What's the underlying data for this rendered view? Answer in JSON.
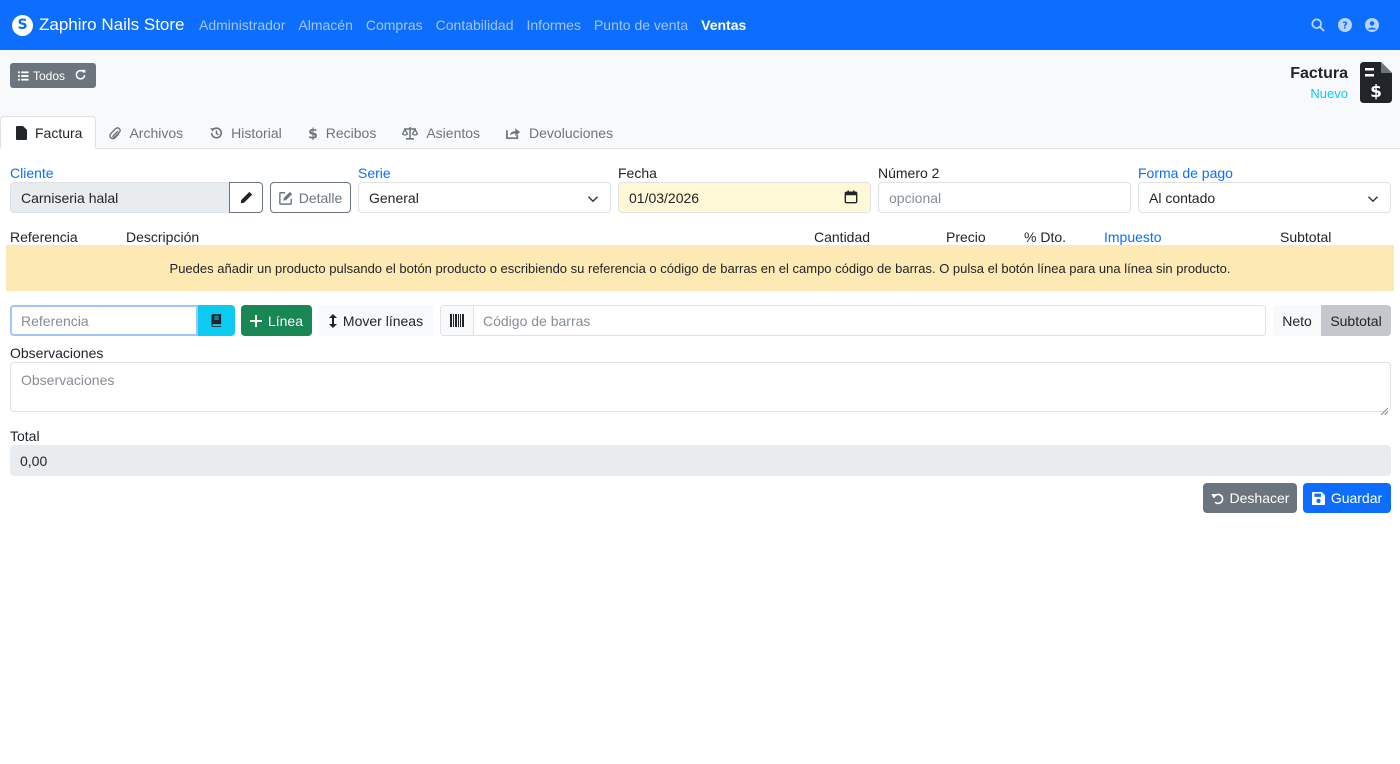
{
  "navbar": {
    "brand": "Zaphiro Nails Store",
    "items": [
      {
        "label": "Administrador",
        "active": false
      },
      {
        "label": "Almacén",
        "active": false
      },
      {
        "label": "Compras",
        "active": false
      },
      {
        "label": "Contabilidad",
        "active": false
      },
      {
        "label": "Informes",
        "active": false
      },
      {
        "label": "Punto de venta",
        "active": false
      },
      {
        "label": "Ventas",
        "active": true
      }
    ],
    "icons": [
      "search-icon",
      "help-icon",
      "user-icon"
    ]
  },
  "toolbar": {
    "todos_label": "Todos"
  },
  "document": {
    "title": "Factura",
    "status": "Nuevo"
  },
  "tabs": [
    {
      "label": "Factura",
      "icon": "file-icon",
      "active": true
    },
    {
      "label": "Archivos",
      "icon": "paperclip-icon",
      "active": false
    },
    {
      "label": "Historial",
      "icon": "history-icon",
      "active": false
    },
    {
      "label": "Recibos",
      "icon": "dollar-icon",
      "active": false
    },
    {
      "label": "Asientos",
      "icon": "balance-scale-icon",
      "active": false
    },
    {
      "label": "Devoluciones",
      "icon": "share-icon",
      "active": false
    }
  ],
  "form": {
    "cliente_label": "Cliente",
    "cliente_value": "Carniseria halal",
    "detalle_label": "Detalle",
    "serie_label": "Serie",
    "serie_value": "General",
    "fecha_label": "Fecha",
    "fecha_value": "01/03/2026",
    "numero2_label": "Número 2",
    "numero2_placeholder": "opcional",
    "forma_pago_label": "Forma de pago",
    "forma_pago_value": "Al contado"
  },
  "lines_header": {
    "referencia": "Referencia",
    "descripcion": "Descripción",
    "cantidad": "Cantidad",
    "precio": "Precio",
    "dto": "% Dto.",
    "impuesto": "Impuesto",
    "subtotal": "Subtotal"
  },
  "alert": {
    "text": "Puedes añadir un producto pulsando el botón producto o escribiendo su referencia o código de barras en el campo código de barras. O pulsa el botón línea para una línea sin producto."
  },
  "actions": {
    "referencia_placeholder": "Referencia",
    "linea_label": "Línea",
    "mover_lineas_label": "Mover líneas",
    "barcode_placeholder": "Código de barras",
    "neto_label": "Neto",
    "subtotal_label": "Subtotal"
  },
  "observaciones": {
    "label": "Observaciones",
    "placeholder": "Observaciones"
  },
  "total": {
    "label": "Total",
    "value": "0,00"
  },
  "footer": {
    "deshacer_label": "Deshacer",
    "guardar_label": "Guardar"
  },
  "colors": {
    "primary": "#0d6efd",
    "secondary": "#6c757d",
    "success": "#198754",
    "info": "#0dcaf0",
    "warning_bg": "#fde9b3"
  }
}
